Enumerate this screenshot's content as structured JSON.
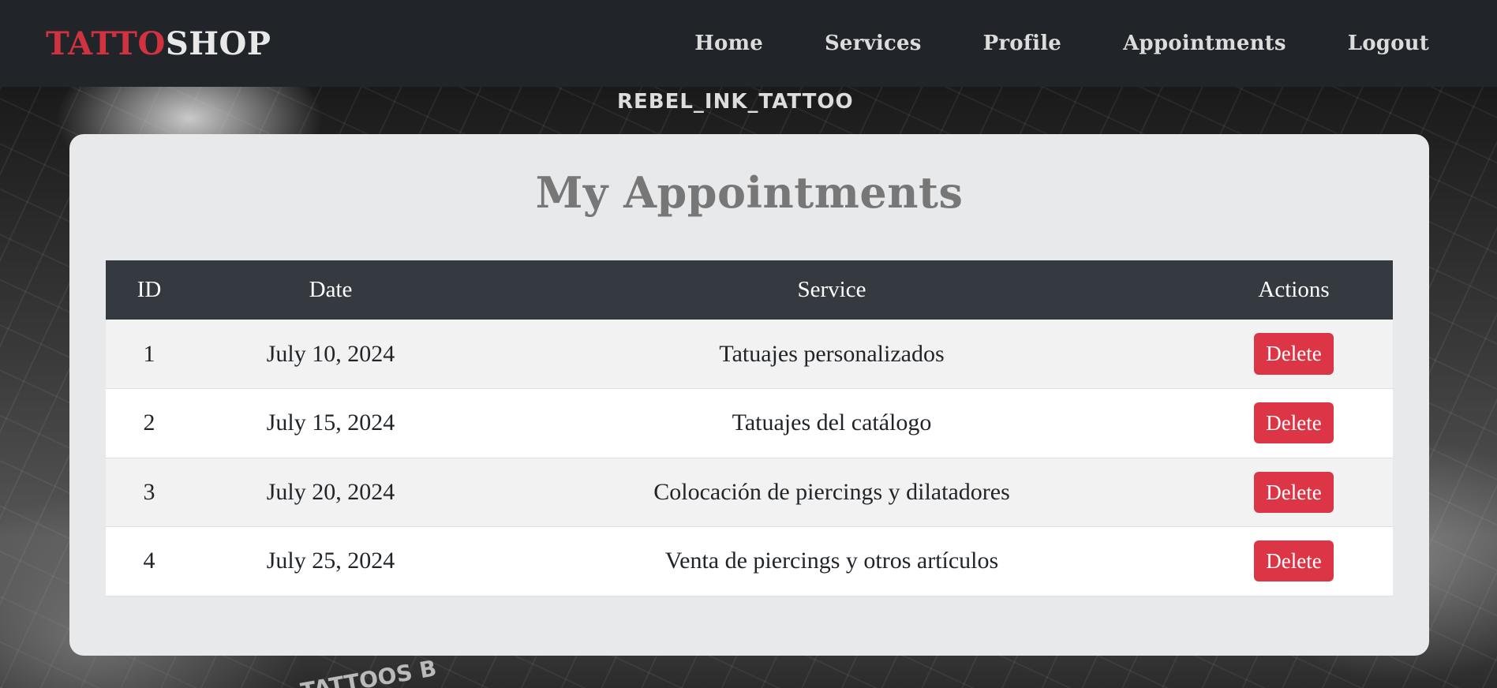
{
  "navbar": {
    "brand_part1": "TATTO",
    "brand_part2": "SHOP",
    "links": [
      {
        "label": "Home"
      },
      {
        "label": "Services"
      },
      {
        "label": "Profile"
      },
      {
        "label": "Appointments"
      },
      {
        "label": "Logout"
      }
    ]
  },
  "background_sign": {
    "handle": "REBEL_INK_TATTOO",
    "bottom_text": "TATTOOS B"
  },
  "main": {
    "title": "My Appointments",
    "table": {
      "headers": [
        "ID",
        "Date",
        "Service",
        "Actions"
      ],
      "rows": [
        {
          "id": "1",
          "date": "July 10, 2024",
          "service": "Tatuajes personalizados",
          "action": "Delete"
        },
        {
          "id": "2",
          "date": "July 15, 2024",
          "service": "Tatuajes del catálogo",
          "action": "Delete"
        },
        {
          "id": "3",
          "date": "July 20, 2024",
          "service": "Colocación de piercings y dilatadores",
          "action": "Delete"
        },
        {
          "id": "4",
          "date": "July 25, 2024",
          "service": "Venta de piercings y otros artículos",
          "action": "Delete"
        }
      ]
    }
  },
  "colors": {
    "navbar_bg": "#212529",
    "brand_accent": "#d1323f",
    "table_header_bg": "#343a40",
    "delete_button": "#dc3545",
    "card_bg": "#e8e9eb"
  }
}
